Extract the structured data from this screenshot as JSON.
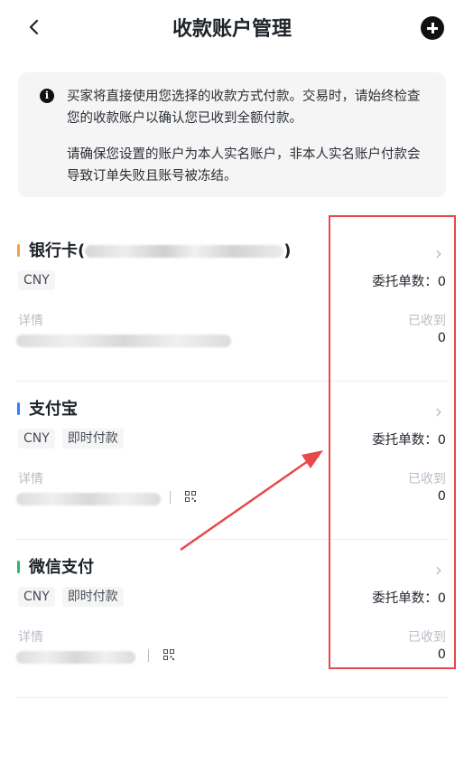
{
  "header": {
    "back_icon": "chevron-left-icon",
    "title": "收款账户管理",
    "add_icon": "plus-circle-icon"
  },
  "notice": {
    "icon": "info-icon",
    "paragraph1": "买家将直接使用您选择的收款方式付款。交易时，请始终检查您的收款账户以确认您已收到全额付款。",
    "paragraph2": "请确保您设置的账户为本人实名账户，非本人实名账户付款会导致订单失败且账号被冻结。"
  },
  "accounts": [
    {
      "name_prefix": "银行卡(",
      "name_suffix": ")",
      "bar_color": "#f0a24a",
      "tags": [
        "CNY"
      ],
      "orders": "委托单数：0",
      "detail_label": "详情",
      "received_label": "已收到",
      "received_value": "0"
    },
    {
      "name_prefix": "支付宝",
      "name_suffix": "",
      "bar_color": "#3b7cf5",
      "tags": [
        "CNY",
        "即时付款"
      ],
      "orders": "委托单数：0",
      "detail_label": "详情",
      "received_label": "已收到",
      "received_value": "0",
      "qr_icon": "qr-code-icon"
    },
    {
      "name_prefix": "微信支付",
      "name_suffix": "",
      "bar_color": "#2fb56a",
      "tags": [
        "CNY",
        "即时付款"
      ],
      "orders": "委托单数：0",
      "detail_label": "详情",
      "received_label": "已收到",
      "received_value": "0",
      "qr_icon": "qr-code-icon"
    }
  ],
  "annotation": {
    "highlight_color": "#e8474b"
  }
}
